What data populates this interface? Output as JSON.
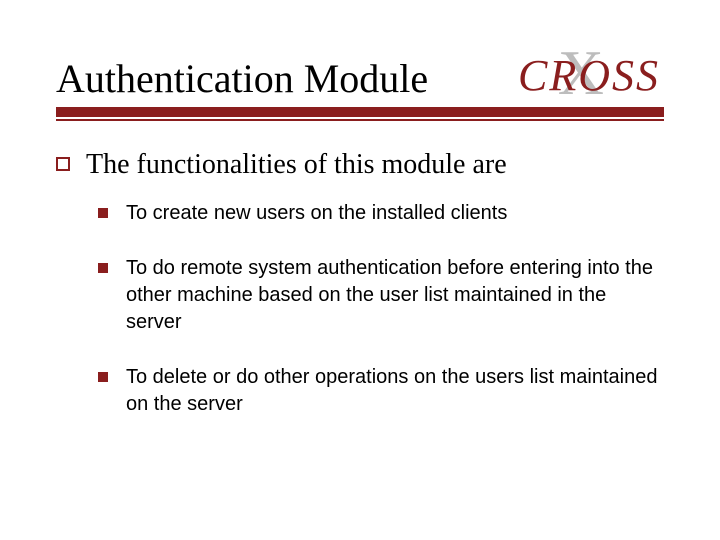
{
  "header": {
    "title": "Authentication Module",
    "logo_text": "CROSS"
  },
  "body": {
    "intro": "The functionalities of this module are",
    "sub_items": [
      "To create new users on the installed clients",
      "To do remote system authentication before entering into the other machine based on the user list maintained in the server",
      "To delete or do other operations on the users list maintained on the server"
    ]
  },
  "colors": {
    "accent": "#8a1e1e"
  }
}
